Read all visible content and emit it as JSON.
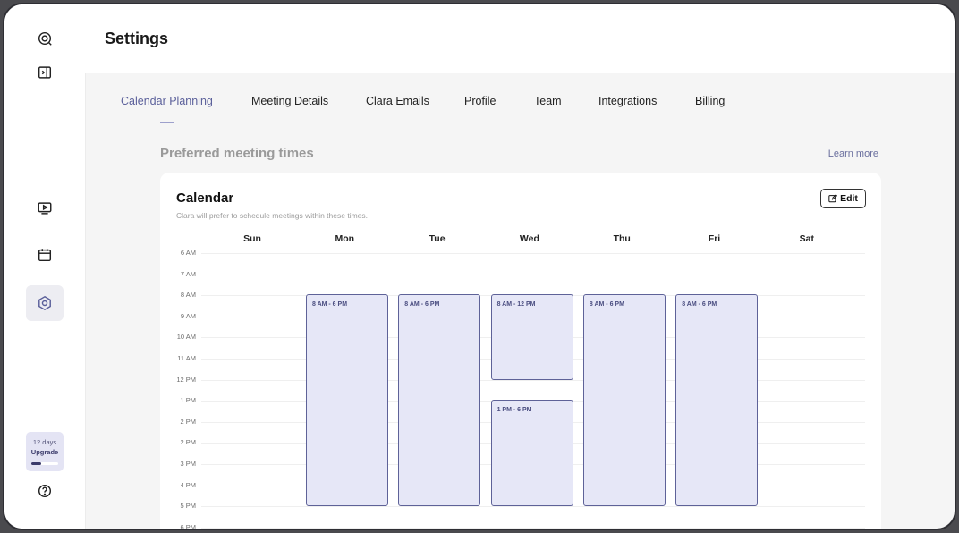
{
  "app": {
    "title": "Settings"
  },
  "sidebar": {
    "icons": [
      "logo-icon",
      "sidebar-toggle-icon",
      "video-icon",
      "calendar-icon",
      "settings-icon",
      "help-icon"
    ],
    "trial": {
      "days_text": "12 days",
      "upgrade_label": "Upgrade",
      "progress": 0.35
    }
  },
  "tabs": [
    {
      "label": "Calendar Planning",
      "active": true
    },
    {
      "label": "Meeting Details"
    },
    {
      "label": "Clara Emails"
    },
    {
      "label": "Profile"
    },
    {
      "label": "Team"
    },
    {
      "label": "Integrations"
    },
    {
      "label": "Billing"
    }
  ],
  "section": {
    "title": "Preferred meeting times",
    "learn_more": "Learn more"
  },
  "calendar": {
    "title": "Calendar",
    "subtitle": "Clara will prefer to schedule meetings within these times.",
    "edit_label": "Edit",
    "days": [
      "Sun",
      "Mon",
      "Tue",
      "Wed",
      "Thu",
      "Fri",
      "Sat"
    ],
    "hours": [
      "6 AM",
      "7 AM",
      "8 AM",
      "9 AM",
      "10 AM",
      "11 AM",
      "12 PM",
      "1 PM",
      "2 PM",
      "2 PM",
      "3 PM",
      "4 PM",
      "5 PM",
      "6 PM"
    ],
    "blocks": [
      {
        "day": 1,
        "start": 8,
        "end": 18,
        "label": "8 AM - 6 PM"
      },
      {
        "day": 2,
        "start": 8,
        "end": 18,
        "label": "8 AM - 6 PM"
      },
      {
        "day": 3,
        "start": 8,
        "end": 12,
        "label": "8 AM - 12 PM"
      },
      {
        "day": 3,
        "start": 13,
        "end": 18,
        "label": "1 PM - 6 PM"
      },
      {
        "day": 4,
        "start": 8,
        "end": 18,
        "label": "8 AM - 6 PM"
      },
      {
        "day": 5,
        "start": 8,
        "end": 18,
        "label": "8 AM - 6 PM"
      }
    ]
  },
  "colors": {
    "accent": "#5a5f9a",
    "block_fill": "#e6e7f7",
    "block_border": "#5e6298"
  }
}
